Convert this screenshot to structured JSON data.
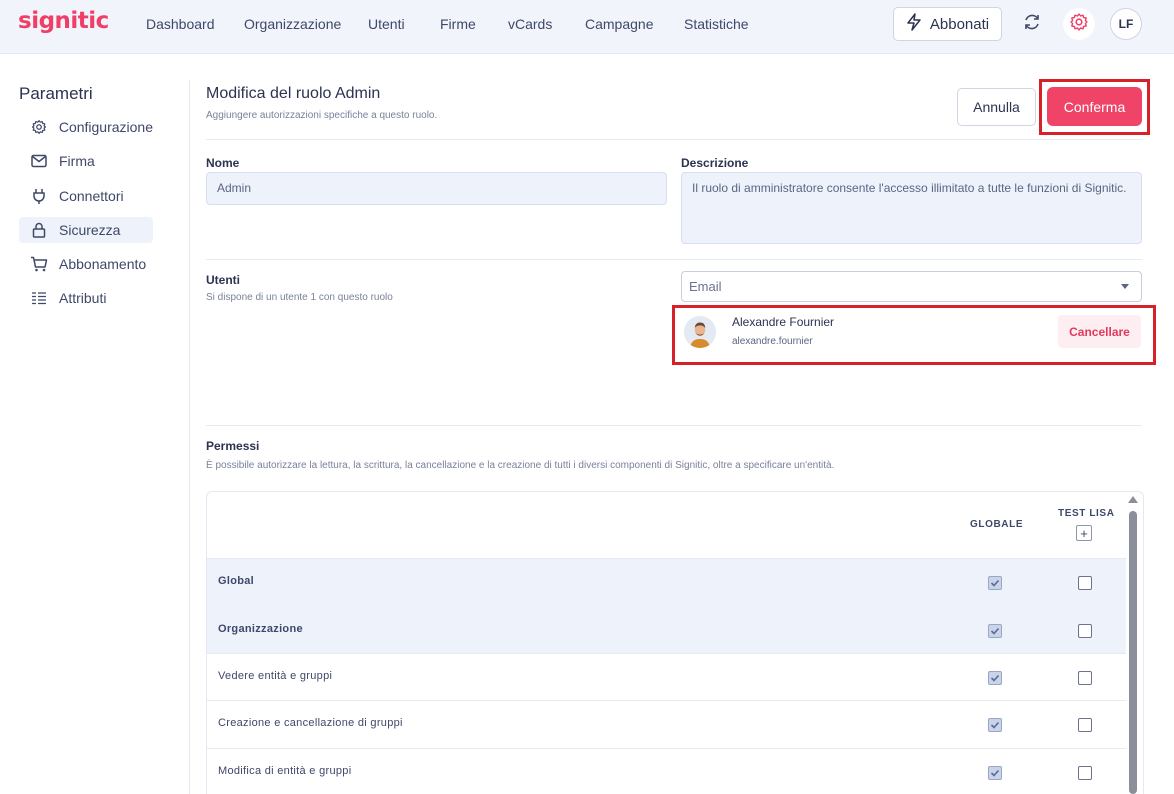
{
  "app": {
    "logo": "signitic",
    "accent_color": "#ef4468"
  },
  "nav": {
    "items": [
      {
        "label": "Dashboard"
      },
      {
        "label": "Organizzazione"
      },
      {
        "label": "Utenti"
      },
      {
        "label": "Firme"
      },
      {
        "label": "vCards"
      },
      {
        "label": "Campagne"
      },
      {
        "label": "Statistiche"
      }
    ],
    "subscribe_label": "Abbonati",
    "subscribe_icon": "lightning-icon",
    "refresh_icon": "refresh-icon",
    "settings_icon": "gear-icon",
    "avatar_initials": "LF"
  },
  "sidebar": {
    "title": "Parametri",
    "items": [
      {
        "label": "Configurazione",
        "icon": "gear-icon"
      },
      {
        "label": "Firma",
        "icon": "mail-icon"
      },
      {
        "label": "Connettori",
        "icon": "plug-icon"
      },
      {
        "label": "Sicurezza",
        "icon": "lock-icon",
        "active": true
      },
      {
        "label": "Abbonamento",
        "icon": "cart-icon"
      },
      {
        "label": "Attributi",
        "icon": "list-icon"
      }
    ]
  },
  "header": {
    "title": "Modifica del ruolo Admin",
    "subtitle": "Aggiungere autorizzazioni specifiche a questo ruolo.",
    "cancel_label": "Annulla",
    "confirm_label": "Conferma"
  },
  "form": {
    "name_label": "Nome",
    "name_value": "Admin",
    "description_label": "Descrizione",
    "description_value": "Il ruolo di amministratore consente l'accesso illimitato a tutte le funzioni di Signitic."
  },
  "users": {
    "label": "Utenti",
    "hint": "Si dispone di un utente 1 con questo ruolo",
    "email_placeholder": "Email",
    "list": [
      {
        "name": "Alexandre Fournier",
        "email": "alexandre.fournier",
        "remove_label": "Cancellare"
      }
    ]
  },
  "permissions": {
    "label": "Permessi",
    "hint": "È possibile autorizzare la lettura, la scrittura, la cancellazione e la creazione di tutti i diversi componenti di Signitic, oltre a specificare un'entità.",
    "columns": [
      "GLOBALE",
      "TEST LISA"
    ],
    "add_column_label": "+",
    "rows": [
      {
        "label": "Global",
        "group": true,
        "globale": true,
        "test_lisa": false
      },
      {
        "label": "Organizzazione",
        "group": true,
        "globale": true,
        "test_lisa": false
      },
      {
        "label": "Vedere entità e gruppi",
        "group": false,
        "globale": true,
        "test_lisa": false
      },
      {
        "label": "Creazione e cancellazione di gruppi",
        "group": false,
        "globale": true,
        "test_lisa": false
      },
      {
        "label": "Modifica di entità e gruppi",
        "group": false,
        "globale": true,
        "test_lisa": false
      }
    ]
  }
}
